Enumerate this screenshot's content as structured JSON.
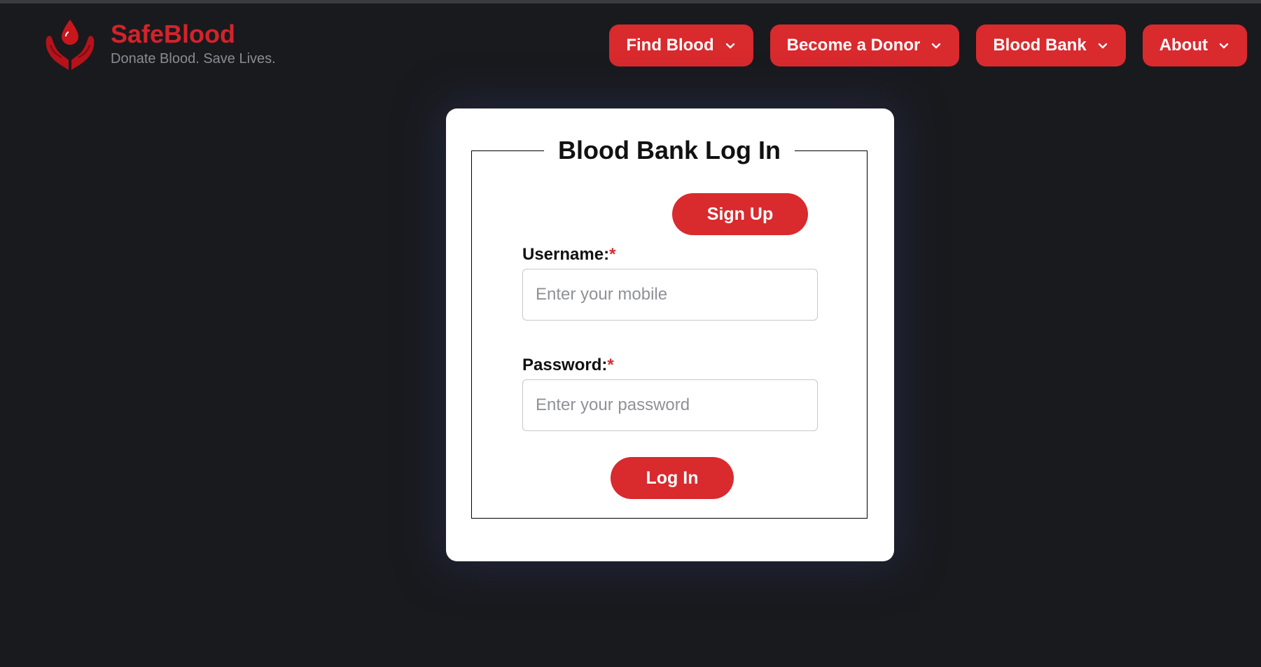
{
  "brand": {
    "title": "SafeBlood",
    "tagline": "Donate Blood. Save Lives.",
    "logo_icon": "blood-drop-hands-icon"
  },
  "nav": [
    {
      "label": "Find Blood",
      "icon": "chevron-down-icon"
    },
    {
      "label": "Become a Donor",
      "icon": "chevron-down-icon"
    },
    {
      "label": "Blood Bank",
      "icon": "chevron-down-icon"
    },
    {
      "label": "About",
      "icon": "chevron-down-icon"
    }
  ],
  "login_form": {
    "legend": "Blood Bank Log In",
    "signup_label": "Sign Up",
    "username_label": "Username:",
    "password_label": "Password:",
    "required_mark": "*",
    "username_placeholder": "Enter your mobile",
    "password_placeholder": "Enter your password",
    "username_value": "",
    "password_value": "",
    "login_label": "Log In"
  },
  "colors": {
    "background": "#191a1e",
    "accent": "#d92a2e",
    "brand_title": "#d4232a",
    "card": "#ffffff"
  }
}
